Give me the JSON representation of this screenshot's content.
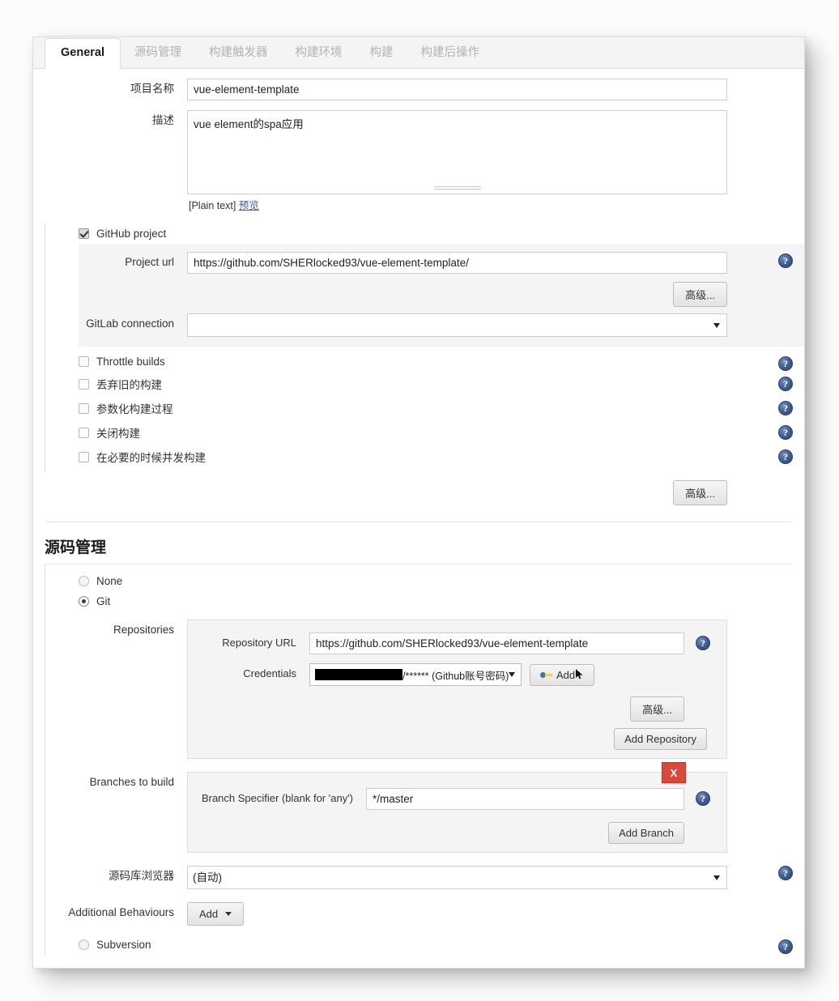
{
  "tabs": [
    {
      "label": "General",
      "active": true
    },
    {
      "label": "源码管理",
      "active": false
    },
    {
      "label": "构建触发器",
      "active": false
    },
    {
      "label": "构建环境",
      "active": false
    },
    {
      "label": "构建",
      "active": false
    },
    {
      "label": "构建后操作",
      "active": false
    }
  ],
  "general": {
    "project_name_label": "项目名称",
    "project_name_value": "vue-element-template",
    "description_label": "描述",
    "description_value": "vue element的spa应用",
    "plain_text_note": "[Plain text]",
    "preview_link": "预览",
    "github_project_label": "GitHub project",
    "github_project_checked": true,
    "project_url_label": "Project url",
    "project_url_value": "https://github.com/SHERlocked93/vue-element-template/",
    "advanced_label": "高级...",
    "gitlab_connection_label": "GitLab connection",
    "gitlab_connection_value": "",
    "checkboxes": [
      {
        "label": "Throttle builds",
        "checked": false
      },
      {
        "label": "丢弃旧的构建",
        "checked": false
      },
      {
        "label": "参数化构建过程",
        "checked": false
      },
      {
        "label": "关闭构建",
        "checked": false
      },
      {
        "label": "在必要的时候并发构建",
        "checked": false
      }
    ],
    "bottom_advanced_label": "高级..."
  },
  "scm": {
    "section_title": "源码管理",
    "options": [
      {
        "label": "None",
        "selected": false
      },
      {
        "label": "Git",
        "selected": true
      },
      {
        "label": "Subversion",
        "selected": false
      }
    ],
    "repositories_label": "Repositories",
    "repository_url_label": "Repository URL",
    "repository_url_value": "https://github.com/SHERlocked93/vue-element-template",
    "credentials_label": "Credentials",
    "credentials_value": "/****** (Github账号密码)",
    "credentials_add_label": "Add",
    "credentials_add_icon": "key-icon",
    "repo_advanced_label": "高级...",
    "add_repository_label": "Add Repository",
    "branches_label": "Branches to build",
    "branch_specifier_label": "Branch Specifier (blank for 'any')",
    "branch_specifier_value": "*/master",
    "branch_delete_label": "X",
    "add_branch_label": "Add Branch",
    "repo_browser_label": "源码库浏览器",
    "repo_browser_value": "(自动)",
    "additional_behaviours_label": "Additional Behaviours",
    "additional_behaviours_add_label": "Add"
  },
  "icons": {
    "help": "?",
    "help_name": "help-icon"
  },
  "colors": {
    "accent_red": "#d9483b",
    "help_blue": "#3c5b8c",
    "link_blue": "#3a5fa0",
    "panel_bg": "#f4f4f5"
  }
}
